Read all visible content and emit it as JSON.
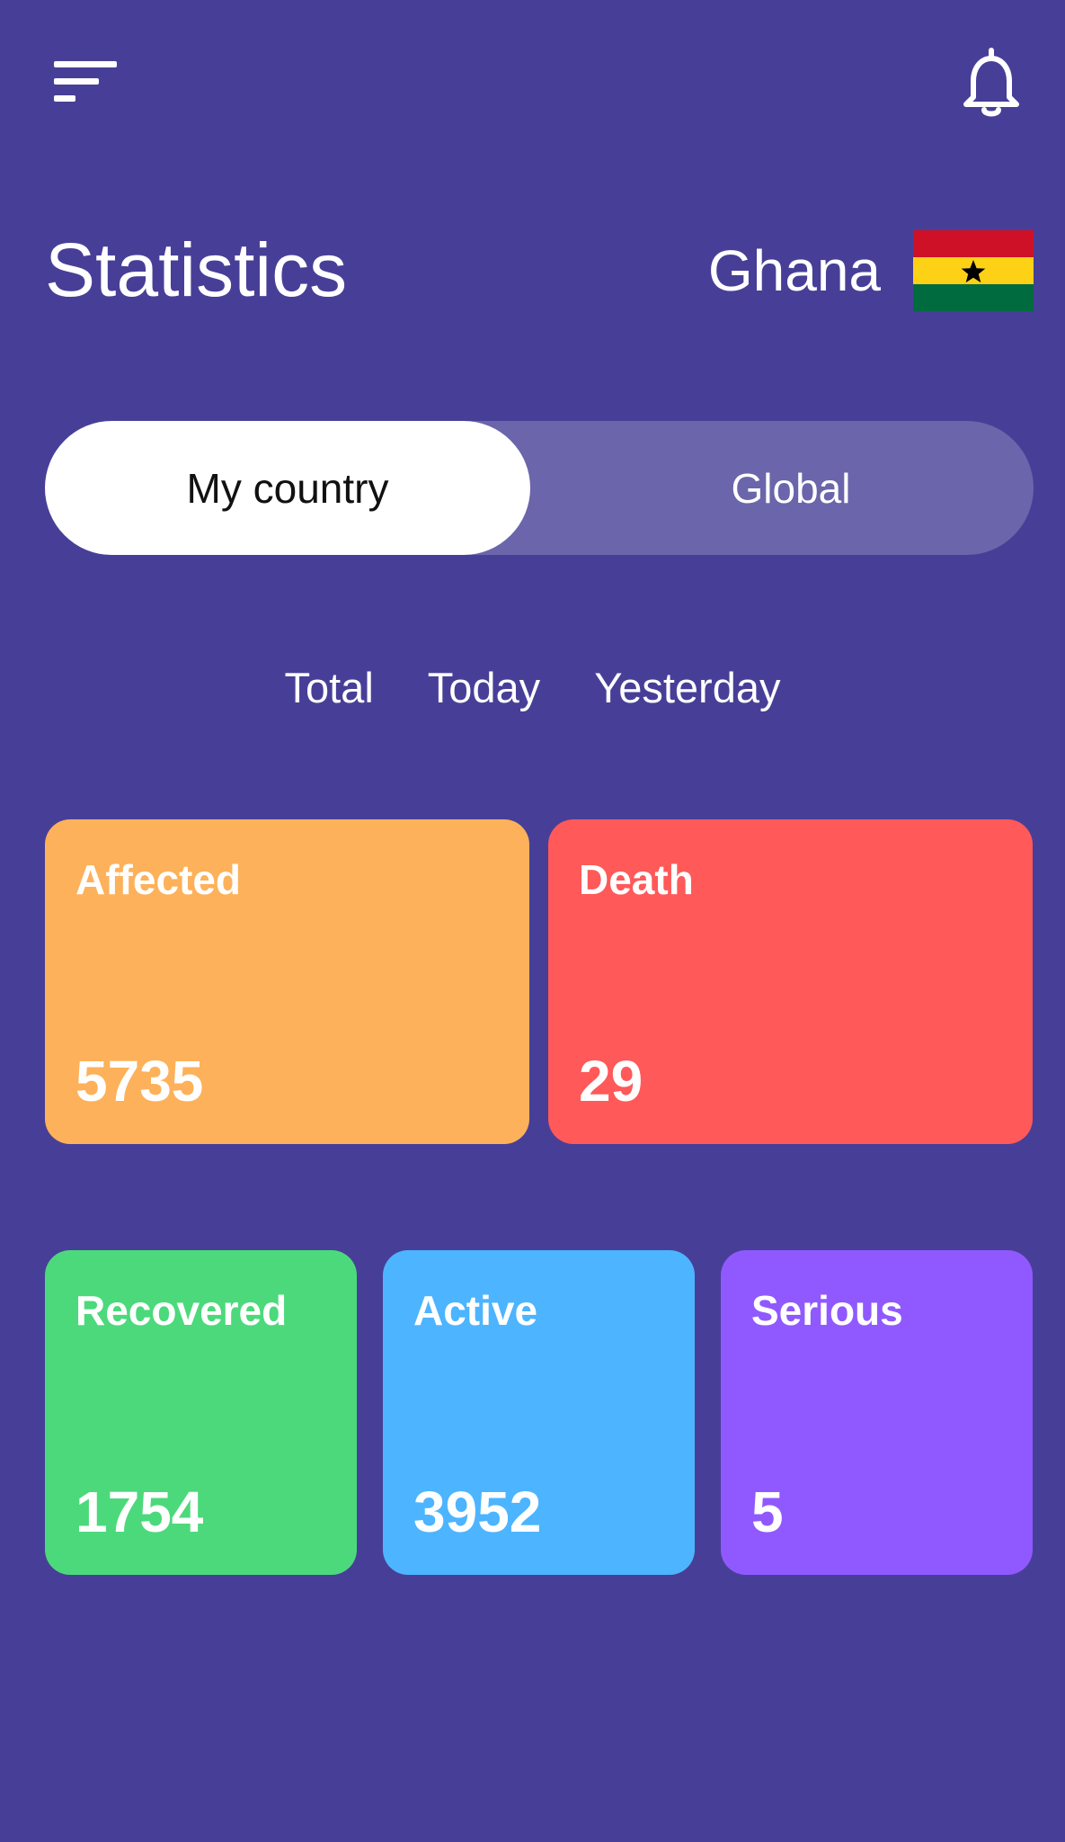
{
  "header": {
    "menu_icon": "menu-icon",
    "notification_icon": "bell-icon"
  },
  "page": {
    "title": "Statistics"
  },
  "country": {
    "name": "Ghana",
    "flag_icon": "ghana-flag-icon",
    "flag_colors": [
      "#CE1126",
      "#FCD116",
      "#006B3F"
    ]
  },
  "scope_toggle": {
    "options": [
      "My country",
      "Global"
    ],
    "selected": "My country"
  },
  "period_tabs": {
    "items": [
      "Total",
      "Today",
      "Yesterday"
    ]
  },
  "stats": {
    "affected": {
      "label": "Affected",
      "value": "5735",
      "color": "#FDB15A"
    },
    "death": {
      "label": "Death",
      "value": "29",
      "color": "#FF5959"
    },
    "recovered": {
      "label": "Recovered",
      "value": "1754",
      "color": "#4CD97B"
    },
    "active": {
      "label": "Active",
      "value": "3952",
      "color": "#4DB4FF"
    },
    "serious": {
      "label": "Serious",
      "value": "5",
      "color": "#9059FF"
    }
  },
  "colors": {
    "background": "#473F97",
    "text": "#FFFFFF"
  }
}
